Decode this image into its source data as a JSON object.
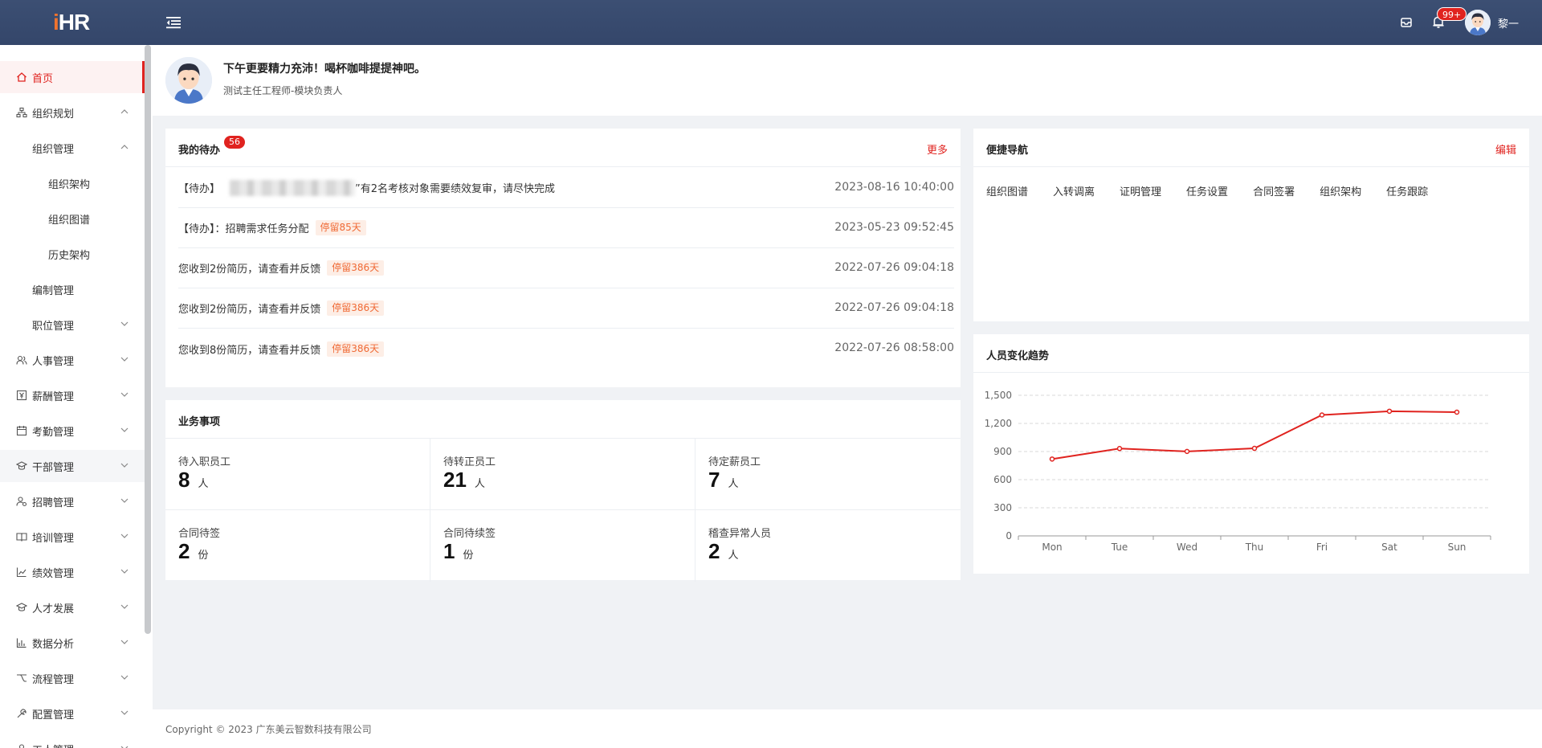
{
  "header": {
    "logo_i": "i",
    "logo_hr": "HR",
    "notification_badge": "99+",
    "user_name": "黎一"
  },
  "sidebar": {
    "items": [
      {
        "label": "首页",
        "icon": "home-icon",
        "active": true
      },
      {
        "label": "组织规划",
        "icon": "org-icon",
        "expanded": true
      },
      {
        "label": "组织管理",
        "indent": 1,
        "expanded": true
      },
      {
        "label": "组织架构",
        "indent": 2
      },
      {
        "label": "组织图谱",
        "indent": 2
      },
      {
        "label": "历史架构",
        "indent": 2
      },
      {
        "label": "编制管理",
        "indent": 1
      },
      {
        "label": "职位管理",
        "indent": 1
      },
      {
        "label": "人事管理",
        "icon": "people-icon"
      },
      {
        "label": "薪酬管理",
        "icon": "salary-icon"
      },
      {
        "label": "考勤管理",
        "icon": "calendar-icon"
      },
      {
        "label": "干部管理",
        "icon": "cadre-icon",
        "hover": true
      },
      {
        "label": "招聘管理",
        "icon": "recruit-icon"
      },
      {
        "label": "培训管理",
        "icon": "training-icon"
      },
      {
        "label": "绩效管理",
        "icon": "performance-icon"
      },
      {
        "label": "人才发展",
        "icon": "talent-icon"
      },
      {
        "label": "数据分析",
        "icon": "analysis-icon"
      },
      {
        "label": "流程管理",
        "icon": "flow-icon"
      },
      {
        "label": "配置管理",
        "icon": "config-icon"
      },
      {
        "label": "工人管理",
        "icon": "worker-icon"
      }
    ]
  },
  "welcome": {
    "title": "下午更要精力充沛！喝杯咖啡提提神吧。",
    "subtitle": "测试主任工程师-模块负责人"
  },
  "todo": {
    "title": "我的待办",
    "badge": "56",
    "more": "更多",
    "items": [
      {
        "prefix": "【待办】",
        "text": "”有2名考核对象需要绩效复审，请尽快完成",
        "time": "2023-08-16 10:40:00",
        "blurred": true
      },
      {
        "prefix": "【待办】：",
        "text": "招聘需求任务分配",
        "tag": "停留85天",
        "time": "2023-05-23 09:52:45"
      },
      {
        "text": "您收到2份简历，请查看并反馈",
        "tag": "停留386天",
        "time": "2022-07-26 09:04:18"
      },
      {
        "text": "您收到2份简历，请查看并反馈",
        "tag": "停留386天",
        "time": "2022-07-26 09:04:18"
      },
      {
        "text": "您收到8份简历，请查看并反馈",
        "tag": "停留386天",
        "time": "2022-07-26 08:58:00"
      }
    ]
  },
  "business": {
    "title": "业务事项",
    "cells": [
      {
        "label": "待入职员工",
        "value": "8",
        "unit": "人"
      },
      {
        "label": "待转正员工",
        "value": "21",
        "unit": "人"
      },
      {
        "label": "待定薪员工",
        "value": "7",
        "unit": "人"
      },
      {
        "label": "合同待签",
        "value": "2",
        "unit": "份"
      },
      {
        "label": "合同待续签",
        "value": "1",
        "unit": "份"
      },
      {
        "label": "稽查异常人员",
        "value": "2",
        "unit": "人"
      }
    ]
  },
  "quicknav": {
    "title": "便捷导航",
    "edit": "编辑",
    "links": [
      "组织图谱",
      "入转调离",
      "证明管理",
      "任务设置",
      "合同签署",
      "组织架构",
      "任务跟踪"
    ]
  },
  "trend": {
    "title": "人员变化趋势"
  },
  "chart_data": {
    "type": "line",
    "categories": [
      "Mon",
      "Tue",
      "Wed",
      "Thu",
      "Fri",
      "Sat",
      "Sun"
    ],
    "series": [
      {
        "values": [
          820,
          932,
          901,
          934,
          1290,
          1330,
          1320
        ]
      }
    ],
    "ylim": [
      0,
      1500
    ],
    "yticks": [
      "0",
      "300",
      "600",
      "900",
      "1,200",
      "1,500"
    ],
    "grid": true,
    "color": "#e0231f"
  },
  "footer": {
    "text": "Copyright © 2023  广东美云智数科技有限公司"
  },
  "colors": {
    "header_bg": "#3c4f73",
    "accent": "#e0231f",
    "tag_text": "#f06a35",
    "tag_bg": "#fdeee6"
  }
}
